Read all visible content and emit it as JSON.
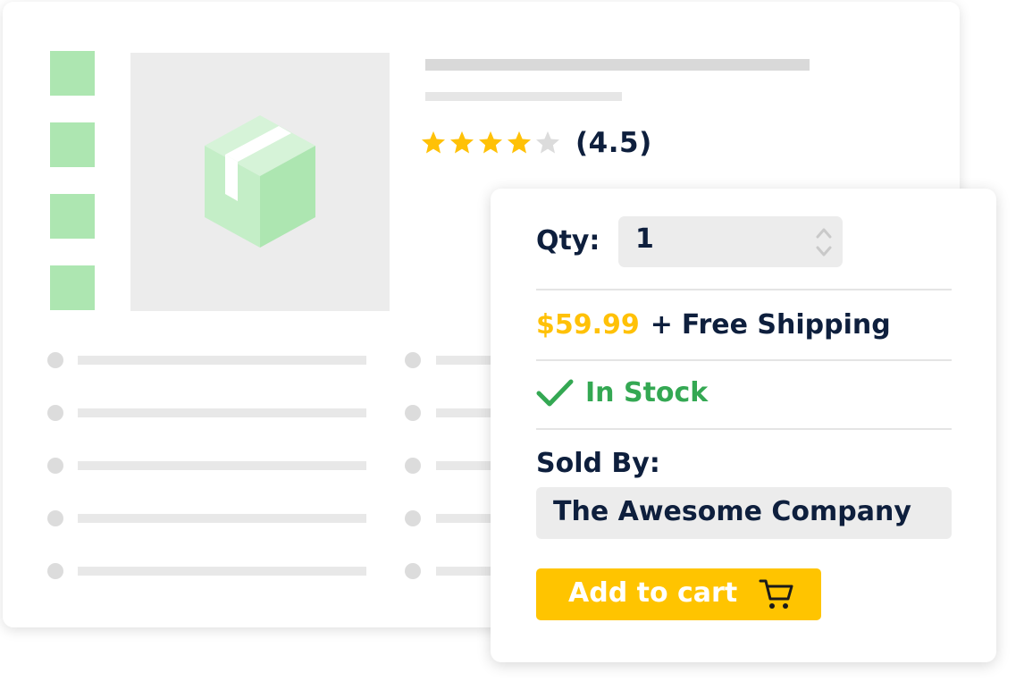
{
  "product": {
    "rating_value": "(4.5)",
    "rating_stars": 4.5,
    "rating_max": 5,
    "thumbnail_count": 4,
    "image_icon": "box-icon"
  },
  "purchase": {
    "qty_label": "Qty:",
    "qty_value": "1",
    "price": "$59.99",
    "plus": "+",
    "shipping": "Free Shipping",
    "stock_status": "In Stock",
    "sold_by_label": "Sold By:",
    "seller": "The Awesome Company",
    "add_to_cart": "Add to cart"
  },
  "colors": {
    "navy": "#0e1f3d",
    "price_yellow": "#ffc107",
    "button_yellow": "#ffc400",
    "stock_green": "#34a853",
    "thumb_green": "#ade6b1",
    "star_gold": "#ffc107",
    "star_empty": "#dcdcdc"
  },
  "icons": [
    "star-icon",
    "check-icon",
    "cart-icon",
    "stepper-icon",
    "box-icon"
  ]
}
